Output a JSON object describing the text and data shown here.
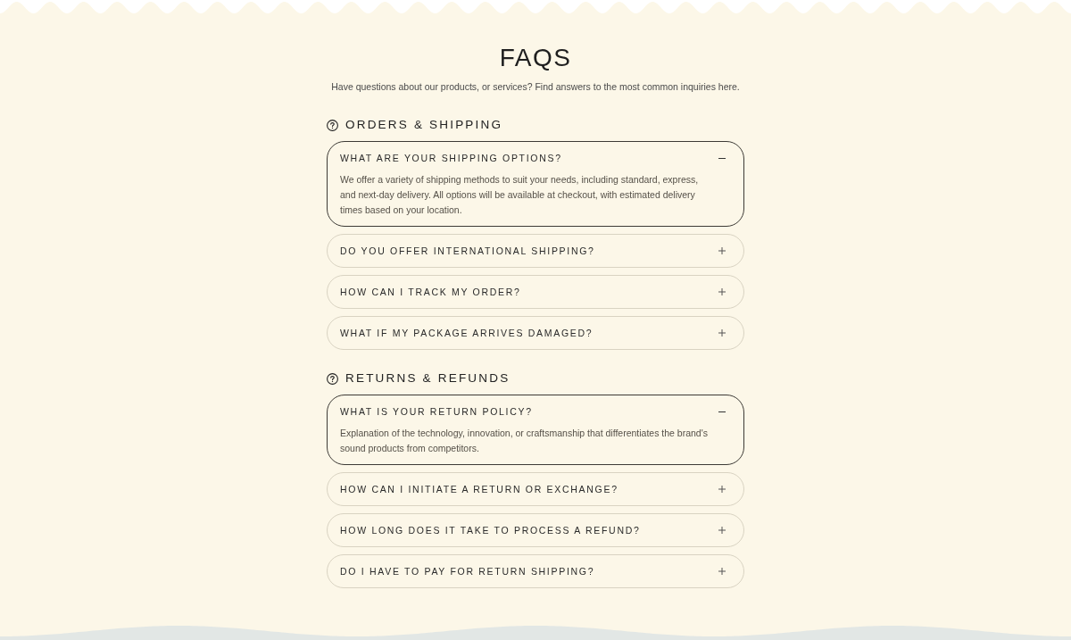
{
  "header": {
    "title": "FAQS",
    "subtitle": "Have questions about our products, or services? Find answers to the most common inquiries here."
  },
  "sections": [
    {
      "heading": "ORDERS & SHIPPING",
      "items": [
        {
          "question": "WHAT ARE YOUR SHIPPING OPTIONS?",
          "expanded": true,
          "answer": "We offer a variety of shipping methods to suit your needs, including standard, express, and next-day delivery. All options will be available at checkout, with estimated delivery times based on your location."
        },
        {
          "question": "DO YOU OFFER INTERNATIONAL SHIPPING?",
          "expanded": false
        },
        {
          "question": "HOW CAN I TRACK MY ORDER?",
          "expanded": false
        },
        {
          "question": "WHAT IF MY PACKAGE ARRIVES DAMAGED?",
          "expanded": false
        }
      ]
    },
    {
      "heading": "RETURNS & REFUNDS",
      "items": [
        {
          "question": "WHAT IS YOUR RETURN POLICY?",
          "expanded": true,
          "answer": "Explanation of the technology, innovation, or craftsmanship that differentiates the brand's sound products from competitors."
        },
        {
          "question": "HOW CAN I INITIATE A RETURN OR EXCHANGE?",
          "expanded": false
        },
        {
          "question": "HOW LONG DOES IT TAKE TO PROCESS A REFUND?",
          "expanded": false
        },
        {
          "question": "DO I HAVE TO PAY FOR RETURN SHIPPING?",
          "expanded": false
        }
      ]
    }
  ]
}
